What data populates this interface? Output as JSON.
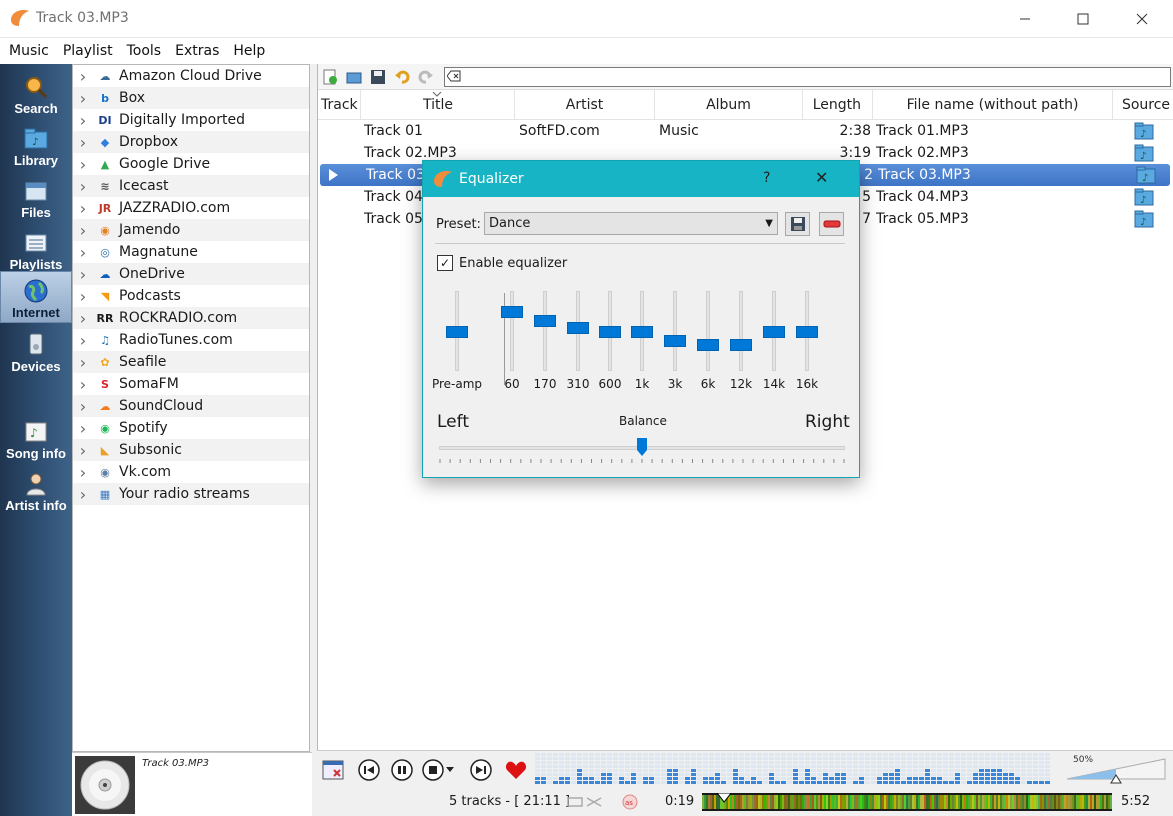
{
  "window": {
    "title": "Track 03.MP3"
  },
  "menu": [
    "Music",
    "Playlist",
    "Tools",
    "Extras",
    "Help"
  ],
  "sidebar": [
    {
      "label": "Search",
      "icon": "search-icon"
    },
    {
      "label": "Library",
      "icon": "library-icon"
    },
    {
      "label": "Files",
      "icon": "files-icon"
    },
    {
      "label": "Playlists",
      "icon": "playlists-icon"
    },
    {
      "label": "Internet",
      "icon": "globe-icon",
      "active": true
    },
    {
      "label": "Devices",
      "icon": "devices-icon"
    },
    {
      "label": "Song info",
      "icon": "song-info-icon"
    },
    {
      "label": "Artist info",
      "icon": "artist-info-icon"
    }
  ],
  "services": [
    {
      "name": "Amazon Cloud Drive",
      "icon": "amazon-cloud-icon",
      "color": "#3a6a96"
    },
    {
      "name": "Box",
      "icon": "box-icon",
      "color": "#1570c9"
    },
    {
      "name": "Digitally Imported",
      "icon": "di-icon",
      "color": "#1d3f8e"
    },
    {
      "name": "Dropbox",
      "icon": "dropbox-icon",
      "color": "#2f7fe0"
    },
    {
      "name": "Google Drive",
      "icon": "google-drive-icon",
      "color": "#34a853"
    },
    {
      "name": "Icecast",
      "icon": "icecast-icon",
      "color": "#555555"
    },
    {
      "name": "JAZZRADIO.com",
      "icon": "jazzradio-icon",
      "color": "#c0392b"
    },
    {
      "name": "Jamendo",
      "icon": "jamendo-icon",
      "color": "#e67e22"
    },
    {
      "name": "Magnatune",
      "icon": "magnatune-icon",
      "color": "#2a6db0"
    },
    {
      "name": "OneDrive",
      "icon": "onedrive-icon",
      "color": "#0f5fc2"
    },
    {
      "name": "Podcasts",
      "icon": "podcast-icon",
      "color": "#f39c12"
    },
    {
      "name": "ROCKRADIO.com",
      "icon": "rockradio-icon",
      "color": "#1a1a1a"
    },
    {
      "name": "RadioTunes.com",
      "icon": "radiotunes-icon",
      "color": "#1f6fb5"
    },
    {
      "name": "Seafile",
      "icon": "seafile-icon",
      "color": "#f1a81c"
    },
    {
      "name": "SomaFM",
      "icon": "somafm-icon",
      "color": "#d7262c"
    },
    {
      "name": "SoundCloud",
      "icon": "soundcloud-icon",
      "color": "#f47a20"
    },
    {
      "name": "Spotify",
      "icon": "spotify-icon",
      "color": "#1db954"
    },
    {
      "name": "Subsonic",
      "icon": "subsonic-icon",
      "color": "#e8a126"
    },
    {
      "name": "Vk.com",
      "icon": "vk-icon",
      "color": "#5b7fa6"
    },
    {
      "name": "Your radio streams",
      "icon": "radio-streams-icon",
      "color": "#3b7bc0"
    }
  ],
  "now_playing": {
    "title": "Track 03.MP3"
  },
  "playlist": {
    "columns": [
      "Track",
      "Title",
      "Artist",
      "Album",
      "Length",
      "File name (without path)",
      "Source"
    ],
    "rows": [
      {
        "track": "",
        "title": "Track 01",
        "artist": "SoftFD.com",
        "album": "Music",
        "length": "2:38",
        "filename": "Track 01.MP3"
      },
      {
        "track": "",
        "title": "Track 02.MP3",
        "artist": "",
        "album": "",
        "length": "3:19",
        "filename": "Track 02.MP3"
      },
      {
        "track": "",
        "title": "Track 03.",
        "artist": "",
        "album": "",
        "length": "2",
        "filename": "Track 03.MP3",
        "playing": true
      },
      {
        "track": "",
        "title": "Track 04.",
        "artist": "",
        "album": "",
        "length": "5",
        "filename": "Track 04.MP3"
      },
      {
        "track": "",
        "title": "Track 05.",
        "artist": "",
        "album": "",
        "length": "7",
        "filename": "Track 05.MP3"
      }
    ]
  },
  "status": {
    "tracks": "5 tracks - [ 21:11 ]",
    "elapsed": "0:19",
    "total": "5:52",
    "volume": "50%",
    "volume_level": 0.5
  },
  "equalizer": {
    "title": "Equalizer",
    "help": "?",
    "close": "✕",
    "preset_label": "Preset:",
    "preset_value": "Dance",
    "enable_label": "Enable equalizer",
    "enabled": true,
    "preamp_label": "Pre-amp",
    "preamp_level": 0.5,
    "bands": [
      {
        "label": "60",
        "level": 0.78
      },
      {
        "label": "170",
        "level": 0.66
      },
      {
        "label": "310",
        "level": 0.55
      },
      {
        "label": "600",
        "level": 0.5
      },
      {
        "label": "1k",
        "level": 0.5
      },
      {
        "label": "3k",
        "level": 0.37
      },
      {
        "label": "6k",
        "level": 0.31
      },
      {
        "label": "12k",
        "level": 0.31
      },
      {
        "label": "14k",
        "level": 0.5
      },
      {
        "label": "16k",
        "level": 0.5
      }
    ],
    "balance_label": "Balance",
    "left_label": "Left",
    "right_label": "Right",
    "balance": 0.5
  },
  "colors": {
    "accent": "#0078d7",
    "eq_title": "#16b4c4",
    "playing_row": "#4a80cf"
  }
}
